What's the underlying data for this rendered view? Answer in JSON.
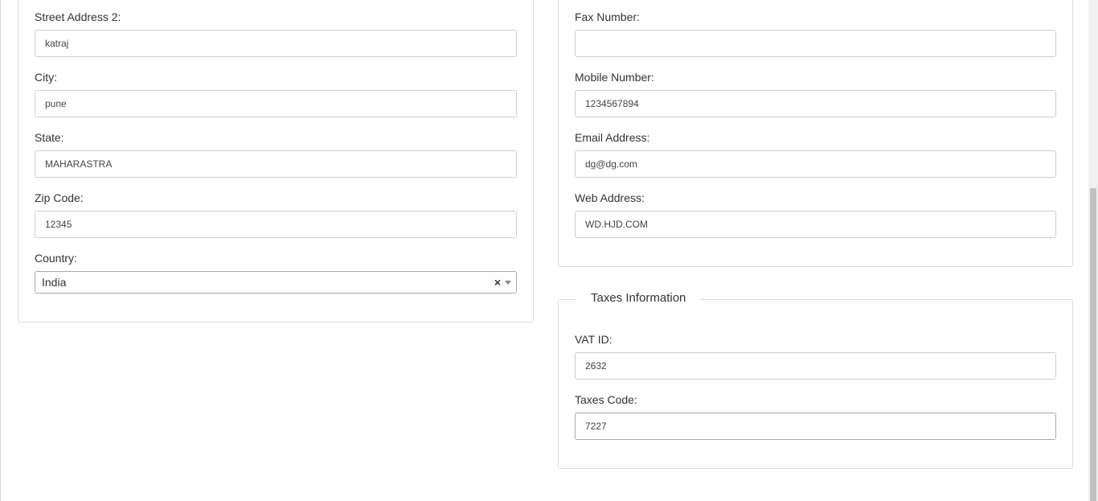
{
  "address": {
    "street2": {
      "label": "Street Address 2:",
      "value": "katraj"
    },
    "city": {
      "label": "City:",
      "value": "pune"
    },
    "state": {
      "label": "State:",
      "value": "MAHARASTRA"
    },
    "zip": {
      "label": "Zip Code:",
      "value": "12345"
    },
    "country": {
      "label": "Country:",
      "value": "India",
      "clear": "×"
    }
  },
  "contact": {
    "fax": {
      "label": "Fax Number:",
      "value": ""
    },
    "mobile": {
      "label": "Mobile Number:",
      "value": "1234567894"
    },
    "email": {
      "label": "Email Address:",
      "value": "dg@dg.com"
    },
    "web": {
      "label": "Web Address:",
      "value": "WD.HJD.COM"
    }
  },
  "taxes": {
    "title": "Taxes Information",
    "vat": {
      "label": "VAT ID:",
      "value": "2632"
    },
    "code": {
      "label": "Taxes Code:",
      "value": "7227"
    }
  }
}
